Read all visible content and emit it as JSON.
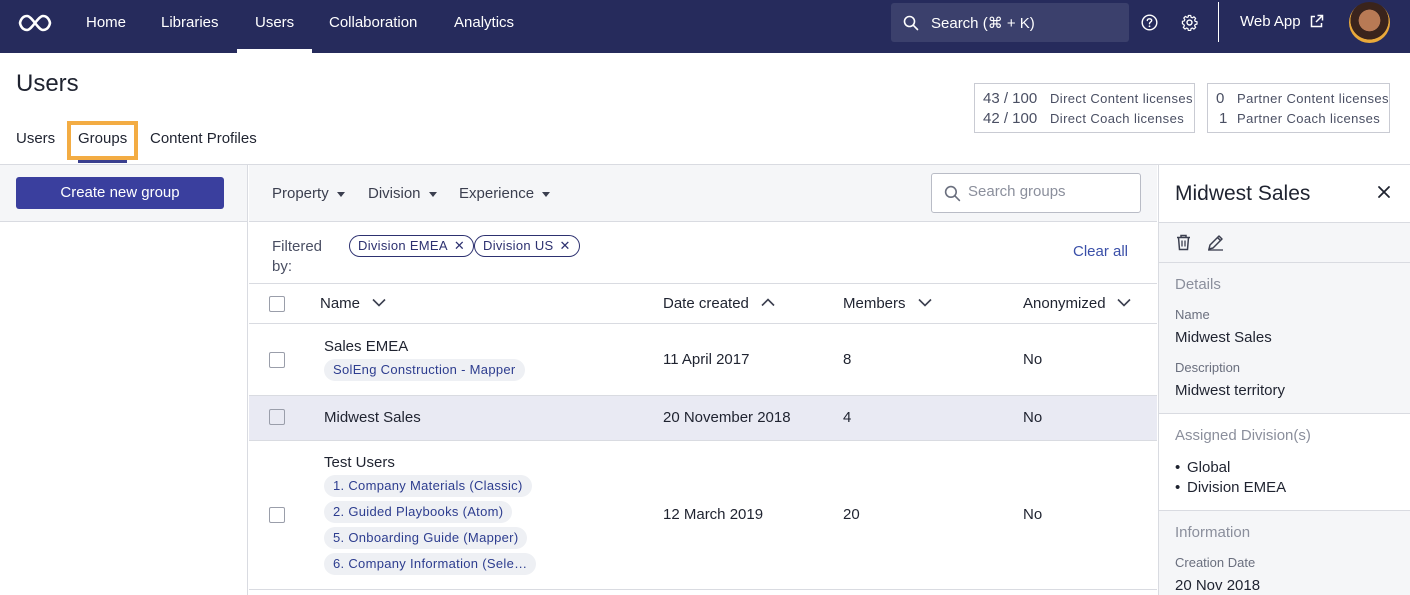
{
  "nav": {
    "items": [
      "Home",
      "Libraries",
      "Users",
      "Collaboration",
      "Analytics"
    ],
    "active": "Users",
    "search_label": "Search (⌘ + K)",
    "web_app_label": "Web App",
    "icons": [
      "infinity-logo-icon",
      "search-icon",
      "help-icon",
      "gear-icon",
      "external-link-icon"
    ]
  },
  "page": {
    "title": "Users",
    "tabs": [
      "Users",
      "Groups",
      "Content Profiles"
    ],
    "active_tab": "Groups"
  },
  "licenses": {
    "direct": [
      {
        "count": "43 / 100",
        "label": "Direct Content licenses"
      },
      {
        "count": "42 / 100",
        "label": "Direct Coach licenses"
      }
    ],
    "partner": [
      {
        "count": "0",
        "label": "Partner Content licenses"
      },
      {
        "count": "1",
        "label": "Partner Coach licenses"
      }
    ]
  },
  "sidebar": {
    "create_button": "Create new group"
  },
  "filters": {
    "dropdowns": [
      "Property",
      "Division",
      "Experience"
    ],
    "search_placeholder": "Search groups",
    "filtered_by_label": "Filtered by:",
    "chips": [
      "Division EMEA",
      "Division US"
    ],
    "clear_all": "Clear all"
  },
  "table": {
    "columns": [
      "Name",
      "Date created",
      "Members",
      "Anonymized"
    ],
    "rows": [
      {
        "name": "Sales EMEA",
        "tags": [
          "SolEng Construction - Mapper"
        ],
        "date": "11 April 2017",
        "members": "8",
        "anonymized": "No",
        "selected": false
      },
      {
        "name": "Midwest Sales",
        "tags": [],
        "date": "20 November 2018",
        "members": "4",
        "anonymized": "No",
        "selected": true
      },
      {
        "name": "Test Users",
        "tags": [
          "1. Company Materials (Classic)",
          "2. Guided Playbooks (Atom)",
          "5. Onboarding Guide (Mapper)",
          "6. Company Information (Sele…"
        ],
        "date": "12 March 2019",
        "members": "20",
        "anonymized": "No",
        "selected": false
      }
    ]
  },
  "details": {
    "title": "Midwest Sales",
    "details_section": "Details",
    "name_label": "Name",
    "name_value": "Midwest Sales",
    "description_label": "Description",
    "description_value": "Midwest territory",
    "divisions_section": "Assigned Division(s)",
    "divisions": [
      "Global",
      "Division EMEA"
    ],
    "information_section": "Information",
    "creation_date_label": "Creation Date",
    "creation_date_value": "20 Nov 2018"
  },
  "colors": {
    "nav_bg": "#262b5c",
    "primary_button": "#3a3f9e",
    "highlight_outline": "#f3ac43",
    "selected_row": "#e9eaf3",
    "link": "#3a4fa8"
  }
}
